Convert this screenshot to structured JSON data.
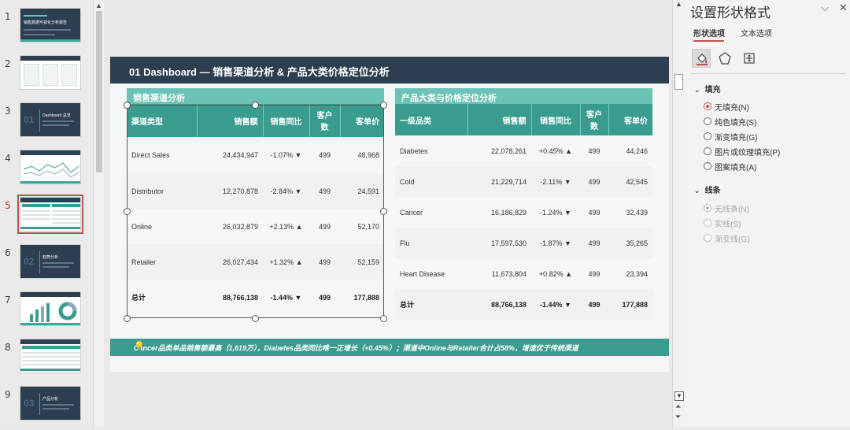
{
  "thumbnails": [
    {
      "number": "1",
      "title": "销售数据可视化分析报告"
    },
    {
      "number": "2",
      "title": ""
    },
    {
      "number": "3",
      "title": "Dashboard 总览",
      "section_number": "01"
    },
    {
      "number": "4",
      "title": ""
    },
    {
      "number": "5",
      "title": "",
      "active": true
    },
    {
      "number": "6",
      "title": "趋势分析",
      "section_number": "02"
    },
    {
      "number": "7",
      "title": ""
    },
    {
      "number": "8",
      "title": ""
    },
    {
      "number": "9",
      "title": "产品分析",
      "section_number": "03"
    }
  ],
  "slide": {
    "title": "01  Dashboard — 销售渠道分析 & 产品大类价格定位分析",
    "channel_table": {
      "caption": "销售渠道分析",
      "headers": [
        "渠道类型",
        "销售额",
        "销售同比",
        "客户数",
        "客单价"
      ],
      "rows": [
        {
          "name": "Direct Sales",
          "sales": "24,434,947",
          "yoy": "-1.07% ▼",
          "yoy_dir": "down",
          "customers": "499",
          "avg": "48,968"
        },
        {
          "name": "Distributor",
          "sales": "12,270,878",
          "yoy": "-2.84% ▼",
          "yoy_dir": "down",
          "customers": "499",
          "avg": "24,591"
        },
        {
          "name": "Online",
          "sales": "26,032,879",
          "yoy": "+2.13% ▲",
          "yoy_dir": "up",
          "customers": "499",
          "avg": "52,170"
        },
        {
          "name": "Retailer",
          "sales": "26,027,434",
          "yoy": "+1.32% ▲",
          "yoy_dir": "up",
          "customers": "499",
          "avg": "52,159"
        }
      ],
      "total": {
        "name": "总计",
        "sales": "88,766,138",
        "yoy": "-1.44% ▼",
        "yoy_dir": "down",
        "customers": "499",
        "avg": "177,888"
      }
    },
    "product_table": {
      "caption": "产品大类与价格定位分析",
      "headers": [
        "一级品类",
        "销售额",
        "销售同比",
        "客户数",
        "客单价"
      ],
      "rows": [
        {
          "name": "Diabetes",
          "sales": "22,078,261",
          "yoy": "+0.45% ▲",
          "yoy_dir": "up",
          "customers": "499",
          "avg": "44,246"
        },
        {
          "name": "Cold",
          "sales": "21,229,714",
          "yoy": "-2.11% ▼",
          "yoy_dir": "down",
          "customers": "499",
          "avg": "42,545"
        },
        {
          "name": "Cancer",
          "sales": "16,186,829",
          "yoy": "-1.24% ▼",
          "yoy_dir": "down",
          "customers": "499",
          "avg": "32,439"
        },
        {
          "name": "Flu",
          "sales": "17,597,530",
          "yoy": "-1.87% ▼",
          "yoy_dir": "down",
          "customers": "499",
          "avg": "35,265"
        },
        {
          "name": "Heart Disease",
          "sales": "11,673,804",
          "yoy": "+0.82% ▲",
          "yoy_dir": "up",
          "customers": "499",
          "avg": "23,394"
        }
      ],
      "total": {
        "name": "总计",
        "sales": "88,766,138",
        "yoy": "-1.44% ▼",
        "yoy_dir": "down",
        "customers": "499",
        "avg": "177,888"
      }
    },
    "insight": "Cancer品类单品销售额最高（1,619万），Diabetes品类同比唯一正增长（+0.45%）；渠道中Online与Retailer合计占58%，增速优于传统渠道"
  },
  "format_pane": {
    "title": "设置形状格式",
    "tabs": [
      "形状选项",
      "文本选项"
    ],
    "fill_section": "填充",
    "fill_options": [
      {
        "label": "无填充(N)",
        "checked": true
      },
      {
        "label": "纯色填充(S)",
        "checked": false
      },
      {
        "label": "渐变填充(G)",
        "checked": false
      },
      {
        "label": "图片或纹理填充(P)",
        "checked": false
      },
      {
        "label": "图案填充(A)",
        "checked": false
      }
    ],
    "line_section": "线条",
    "line_options": [
      {
        "label": "无线条(N)",
        "checked": true
      },
      {
        "label": "实线(S)",
        "checked": false
      },
      {
        "label": "渐变线(G)",
        "checked": false
      }
    ]
  },
  "colors": {
    "header_dark": "#2c3e4f",
    "teal": "#3a9c8e",
    "teal_light": "#6cc3b5",
    "up": "#2f9e52",
    "down": "#d64541",
    "accent": "#c0504d"
  }
}
